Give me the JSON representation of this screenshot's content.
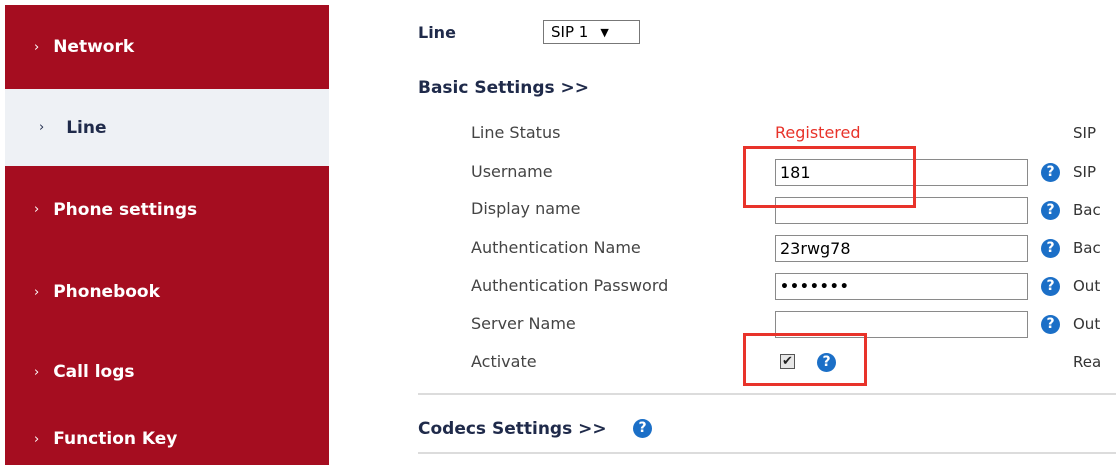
{
  "sidebar": {
    "items": [
      {
        "label": "Network",
        "chevron": "›"
      },
      {
        "label": "Line",
        "chevron": "›"
      },
      {
        "label": "Phone settings",
        "chevron": "›"
      },
      {
        "label": "Phonebook",
        "chevron": "›"
      },
      {
        "label": "Call logs",
        "chevron": "›"
      },
      {
        "label": "Function Key",
        "chevron": "›"
      }
    ],
    "active_index": 1
  },
  "line": {
    "label": "Line",
    "selected": "SIP 1",
    "arrow": "▼"
  },
  "basic_settings": {
    "title": "Basic Settings >>",
    "rows": [
      {
        "label": "Line Status",
        "value": "Registered",
        "right": "SIP"
      },
      {
        "label": "Username",
        "value": "181",
        "right": "SIP"
      },
      {
        "label": "Display name",
        "value": "",
        "right": "Bac"
      },
      {
        "label": "Authentication Name",
        "value": "23rwg78",
        "right": "Bac"
      },
      {
        "label": "Authentication Password",
        "value": "•••••••",
        "right": "Out"
      },
      {
        "label": "Server Name",
        "value": "",
        "right": "Out"
      },
      {
        "label": "Activate",
        "checked": true,
        "right": "Rea"
      }
    ]
  },
  "codecs_settings": {
    "title": "Codecs Settings >>"
  },
  "help_glyph": "?",
  "check_glyph": "✔",
  "colors": {
    "sidebar": "#a50d20",
    "active_item": "#eef1f5",
    "status_registered": "#e8332a",
    "highlight_box": "#e8332a",
    "help_icon": "#1b6fc7"
  }
}
